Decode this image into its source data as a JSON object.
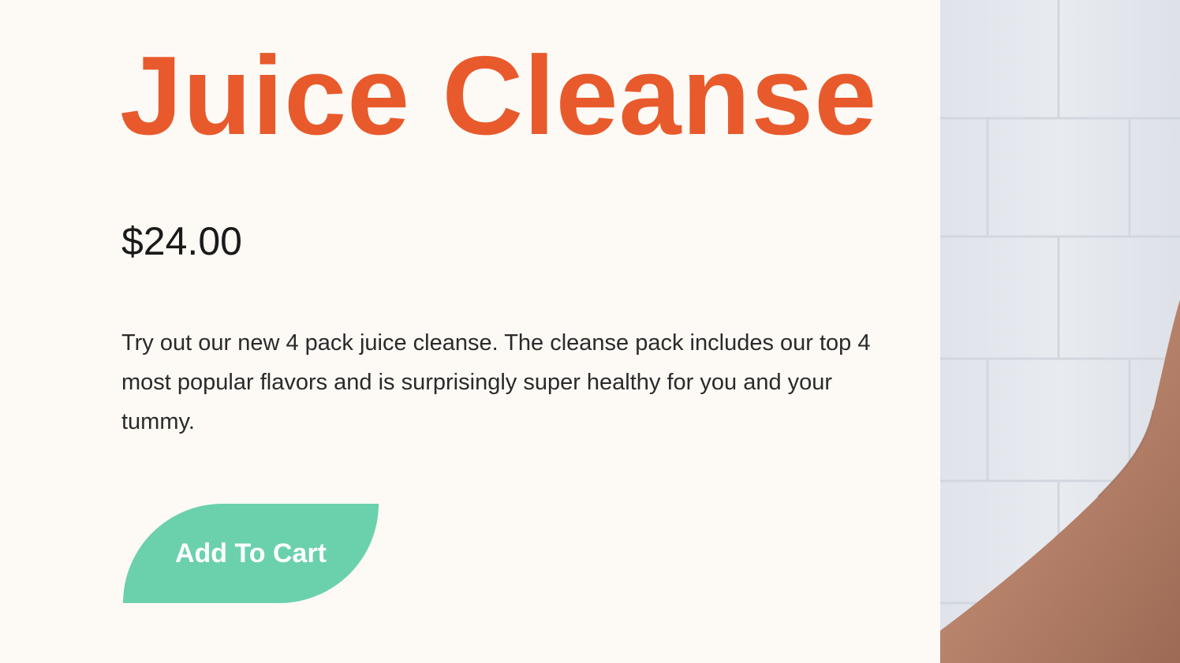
{
  "product": {
    "title": "Juice Cleanse",
    "price": "$24.00",
    "description": "Try out our new 4 pack juice cleanse. The cleanse pack includes our top 4 most popular flavors and is surprisingly super healthy for you and your tummy.",
    "add_to_cart_label": "Add To Cart"
  },
  "colors": {
    "title": "#e85a2c",
    "button": "#6bd1ad",
    "background": "#fdfaf6"
  },
  "hero_image": {
    "subject": "person-arm-against-white-brick-wall"
  }
}
